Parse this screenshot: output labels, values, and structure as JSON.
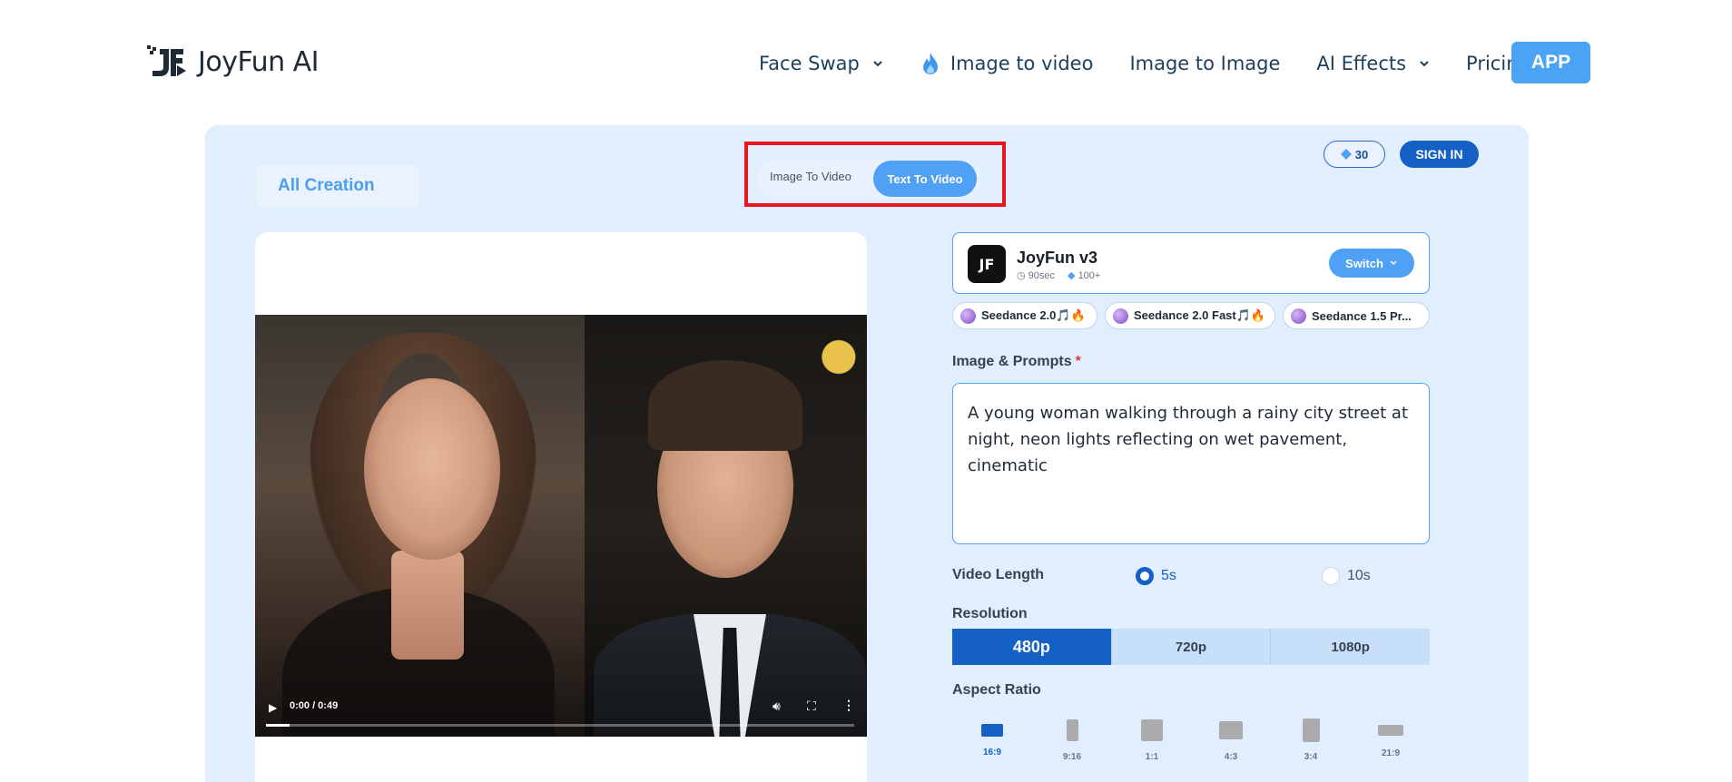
{
  "brand": {
    "name": "JoyFun AI",
    "mark": "JF"
  },
  "nav": {
    "items": [
      {
        "label": "Face Swap",
        "has_dropdown": true
      },
      {
        "label": "Image to video",
        "icon": "flame-icon"
      },
      {
        "label": "Image to Image"
      },
      {
        "label": "AI Effects",
        "has_dropdown": true
      },
      {
        "label": "Pricing"
      }
    ],
    "app_button": "APP"
  },
  "toolbar": {
    "all_creation": "All Creation",
    "mode_tabs": [
      "Image To Video",
      "Text To Video"
    ],
    "active_mode": "Text To Video",
    "credits": "30",
    "sign_in": "SIGN IN"
  },
  "video": {
    "time": "0:00 / 0:49",
    "progress_percent": 4
  },
  "model": {
    "logo_text": "JF",
    "name": "JoyFun v3",
    "duration": "90sec",
    "cost": "100+",
    "switch_label": "Switch"
  },
  "model_chips": [
    {
      "label": "Seedance 2.0🎵🔥"
    },
    {
      "label": "Seedance 2.0 Fast🎵🔥"
    },
    {
      "label": "Seedance 1.5 Pr..."
    }
  ],
  "prompt": {
    "label": "Image & Prompts",
    "required_mark": "*",
    "value": "A young woman walking through a rainy city street at night, neon lights reflecting on wet pavement, cinematic"
  },
  "video_length": {
    "label": "Video Length",
    "options": [
      "5s",
      "10s"
    ],
    "selected": "5s"
  },
  "resolution": {
    "label": "Resolution",
    "options": [
      "480p",
      "720p",
      "1080p"
    ],
    "selected": "480p"
  },
  "aspect_ratio": {
    "label": "Aspect Ratio",
    "options": [
      "16:9",
      "9:16",
      "1:1",
      "4:3",
      "3:4",
      "21:9"
    ],
    "selected": "16:9"
  },
  "colors": {
    "accent": "#4ea1f4",
    "primary": "#1460c5",
    "panel": "#e1eefe",
    "highlight": "#e8141c"
  }
}
